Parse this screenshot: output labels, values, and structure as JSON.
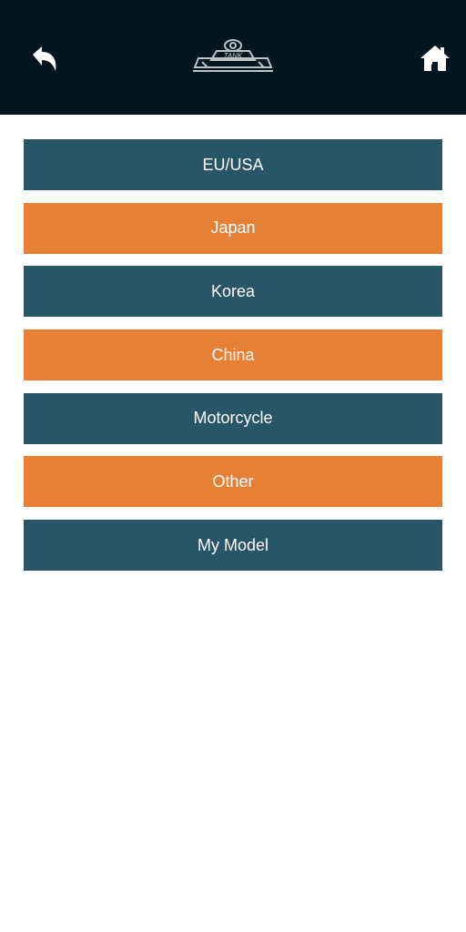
{
  "header": {
    "back_icon": "back-arrow-icon",
    "home_icon": "home-icon",
    "logo_text": "TANK"
  },
  "colors": {
    "header_bg": "#031520",
    "dark_button": "#285667",
    "orange_button": "#e58035"
  },
  "menu": {
    "items": [
      {
        "label": "EU/USA"
      },
      {
        "label": "Japan"
      },
      {
        "label": "Korea"
      },
      {
        "label": "China"
      },
      {
        "label": "Motorcycle"
      },
      {
        "label": "Other"
      },
      {
        "label": "My Model"
      }
    ]
  }
}
